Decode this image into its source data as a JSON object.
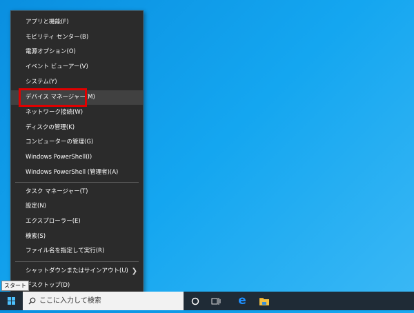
{
  "menu": {
    "items": [
      {
        "label": "アプリと機能(F)"
      },
      {
        "label": "モビリティ センター(B)"
      },
      {
        "label": "電源オプション(O)"
      },
      {
        "label": "イベント ビューアー(V)"
      },
      {
        "label": "システム(Y)"
      },
      {
        "label": "デバイス マネージャー(M)"
      },
      {
        "label": "ネットワーク接続(W)"
      },
      {
        "label": "ディスクの管理(K)"
      },
      {
        "label": "コンピューターの管理(G)"
      },
      {
        "label": "Windows PowerShell(I)"
      },
      {
        "label": "Windows PowerShell (管理者)(A)"
      },
      {
        "label": "タスク マネージャー(T)"
      },
      {
        "label": "設定(N)"
      },
      {
        "label": "エクスプローラー(E)"
      },
      {
        "label": "検索(S)"
      },
      {
        "label": "ファイル名を指定して実行(R)"
      },
      {
        "label": "シャットダウンまたはサインアウト(U)"
      },
      {
        "label": "デスクトップ(D)"
      }
    ]
  },
  "taskbar": {
    "search_placeholder": "ここに入力して検索",
    "tooltip": "スタート"
  },
  "colors": {
    "highlight_box": "#e00000",
    "edge": "#1e90ff",
    "explorer": "#f5c242"
  }
}
